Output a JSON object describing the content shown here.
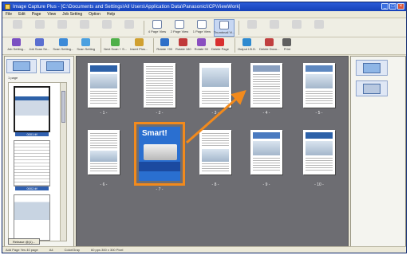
{
  "window": {
    "title": "Image Capture Plus - [C:\\Documents and Settings\\All Users\\Application Data\\Panasonic\\ICP\\ViewWork]"
  },
  "menu": [
    "File",
    "Edit",
    "Page",
    "View",
    "Job Setting",
    "Option",
    "Help"
  ],
  "toolbar1": [
    {
      "id": "btn1",
      "label": "",
      "kind": "disabled"
    },
    {
      "id": "btn2",
      "label": "",
      "kind": "disabled"
    },
    {
      "id": "btn3",
      "label": "",
      "kind": "disabled"
    },
    {
      "id": "btn4",
      "label": "",
      "kind": "disabled"
    },
    {
      "id": "btn5",
      "label": "",
      "kind": "disabled"
    },
    {
      "id": "btn6",
      "label": "",
      "kind": "disabled"
    },
    {
      "id": "view1",
      "label": "4 Page View",
      "kind": "view"
    },
    {
      "id": "view2",
      "label": "2 Page View",
      "kind": "view"
    },
    {
      "id": "view3",
      "label": "1 Page View",
      "kind": "view"
    },
    {
      "id": "view4",
      "label": "Thumbnail Vi...",
      "kind": "active"
    },
    {
      "id": "btn7",
      "label": "",
      "kind": "disabled"
    },
    {
      "id": "btn8",
      "label": "",
      "kind": "disabled"
    },
    {
      "id": "btn9",
      "label": "",
      "kind": "disabled"
    },
    {
      "id": "btn10",
      "label": "",
      "kind": "disabled"
    }
  ],
  "toolbar2": [
    {
      "label": "Job Setting...",
      "color": "#7a4fc2"
    },
    {
      "label": "Job Scan Se...",
      "color": "#5a6fd0"
    },
    {
      "label": "Scan Setting...",
      "color": "#3c8ad8"
    },
    {
      "label": "Scan Setting",
      "color": "#4aa0e0"
    },
    {
      "label": "Next Scan + S...",
      "color": "#4fb04a"
    },
    {
      "label": "Insert Plus...",
      "color": "#d0a030"
    },
    {
      "label": "Rotate +90",
      "color": "#2e6fc8"
    },
    {
      "label": "Rotate 180",
      "color": "#c03a3a"
    },
    {
      "label": "Rotate 90",
      "color": "#8a4fc0"
    },
    {
      "label": "Delete Page",
      "color": "#d83030"
    },
    {
      "label": "Output I.B.D.",
      "color": "#2e8ad0"
    },
    {
      "label": "Delete Docu...",
      "color": "#c04040"
    },
    {
      "label": "Print",
      "color": "#606060"
    }
  ],
  "left_panel": {
    "label": "1 page",
    "thumbs": [
      {
        "caption": "0001.tif"
      },
      {
        "caption": "0002.tif"
      },
      {
        "caption": "0003.tif"
      }
    ],
    "button_label": "Release @(1)..."
  },
  "pages": [
    {
      "label": "- 1 -"
    },
    {
      "label": "- 2 -"
    },
    {
      "label": "- 3 -"
    },
    {
      "label": "- 4 -"
    },
    {
      "label": "- 5 -"
    },
    {
      "label": "- 6 -"
    },
    {
      "label": "- 7 -"
    },
    {
      "label": "- 8 -"
    },
    {
      "label": "- 9 -"
    },
    {
      "label": "- 10 -"
    }
  ],
  "highlight_page": {
    "title": "Smart!"
  },
  "statusbar": [
    "Add Page   Yes   40 page",
    "A4",
    "Color/Gray",
    "60 pps   300 x 300 Pixel"
  ],
  "colors": {
    "accent_orange": "#f28a1c",
    "canvas_gray": "#6d6d72"
  }
}
